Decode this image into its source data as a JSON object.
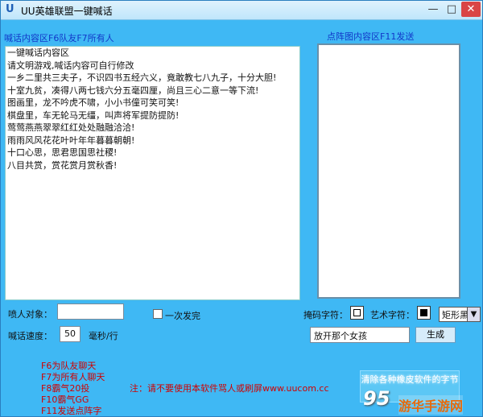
{
  "window": {
    "logo": "U",
    "title": "UU英雄联盟一键喊话",
    "minimize": "—",
    "maximize": "□",
    "close": "✕"
  },
  "labels": {
    "shout_area": "喊话内容区F6队友F7所有人",
    "pattern_area": "点阵图内容区F11发送",
    "target": "喷人对象：",
    "once": "一次发完",
    "speed": "喊话速度：",
    "speed_unit": "毫秒/行",
    "mask_char": "掩码字符：",
    "art_char": "艺术字符："
  },
  "shout_lines": [
    "一键喊话内容区",
    "请文明游戏,喊话内容可自行修改",
    "一乡二里共三夫子，不识四书五经六义，竟敢教七八九子，十分大胆!",
    "十室九贫，凑得八两七钱六分五毫四厘，尚且三心二意一等下流!",
    "图画里，龙不吟虎不啸，小小书僮可笑可笑!",
    "棋盘里，车无轮马无缰，叫声将军提防提防!",
    "莺莺燕燕翠翠红红处处融融洽洽!",
    "雨雨风风花花叶叶年年暮暮朝朝!",
    "十口心思，思君思国思社稷!",
    "八目共赏，赏花赏月赏秋香!"
  ],
  "inputs": {
    "target_value": "",
    "speed_value": "50",
    "generate_text": "放开那个女孩"
  },
  "select": {
    "selected": "矩形黑",
    "arrow": "▼"
  },
  "buttons": {
    "generate": "生成",
    "clear": "清除各种橡皮软件的字节"
  },
  "hotkeys": [
    "F6为队友聊天",
    "F7为所有人聊天",
    "F8霸气20投",
    "F10霸气GG",
    "F11发送点阵字"
  ],
  "notice": "注：请不要使用本软件骂人或刷屏www.uucom.cc",
  "watermark": {
    "number": "95",
    "text": "游华手游网"
  },
  "colors": {
    "window_bg": "#3fb8f4",
    "label_blue": "#1238c9",
    "hotkey_red": "#d00000"
  }
}
